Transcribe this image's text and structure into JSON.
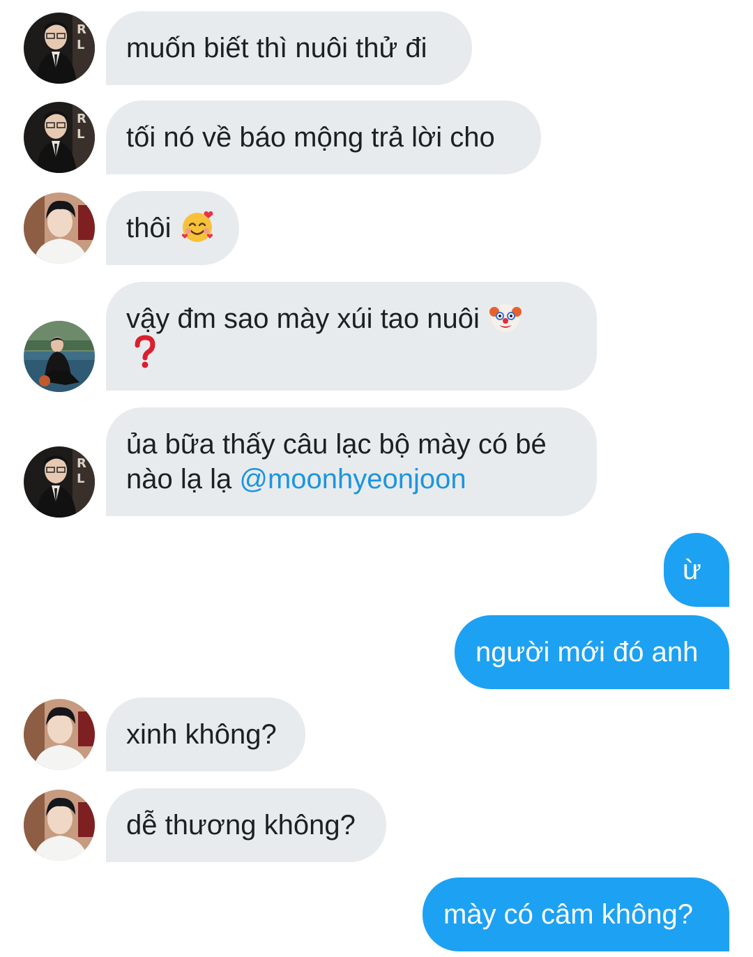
{
  "conversation": {
    "messages": [
      {
        "sender": "other",
        "avatar": "avatar-guy-glasses",
        "text": "muốn biết thì nuôi thử đi"
      },
      {
        "sender": "other",
        "avatar": "avatar-guy-glasses",
        "text": "tối nó về báo mộng trả lời cho"
      },
      {
        "sender": "other",
        "avatar": "avatar-guy-white-shirt",
        "text": "thôi",
        "emoji": "smiling-face-with-hearts-emoji"
      },
      {
        "sender": "other",
        "avatar": "avatar-guy-court",
        "text": "vậy đm sao mày xúi tao nuôi",
        "emoji": "clown-face-emoji",
        "emoji2": "question-mark-emoji"
      },
      {
        "sender": "other",
        "avatar": "avatar-guy-glasses",
        "text_line1": "ủa bữa thấy câu lạc bộ mày có bé",
        "text_line2_prefix": "nào lạ lạ ",
        "mention": "@moonhyeonjoon"
      },
      {
        "sender": "me",
        "text": "ừ"
      },
      {
        "sender": "me",
        "text": "người mới đó anh"
      },
      {
        "sender": "other",
        "avatar": "avatar-guy-white-shirt",
        "text": "xinh không?"
      },
      {
        "sender": "other",
        "avatar": "avatar-guy-white-shirt",
        "text": "dễ thương không?"
      },
      {
        "sender": "me",
        "text": "mày có câm không?"
      }
    ]
  },
  "colors": {
    "incoming_bubble": "#e8ebee",
    "outgoing_bubble": "#1da1f2",
    "mention": "#1b95e0",
    "text": "#1c1f23"
  }
}
